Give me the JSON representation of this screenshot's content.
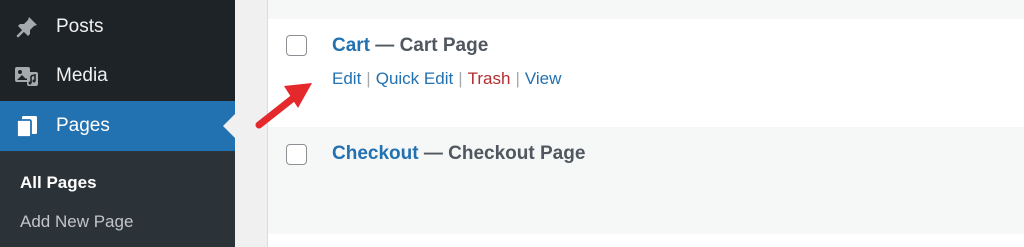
{
  "sidebar": {
    "items": [
      {
        "label": "Posts",
        "icon": "pushpin-icon"
      },
      {
        "label": "Media",
        "icon": "media-icon"
      },
      {
        "label": "Pages",
        "icon": "pages-icon"
      }
    ],
    "submenu": [
      {
        "label": "All Pages"
      },
      {
        "label": "Add New Page"
      }
    ]
  },
  "rows": [
    {
      "title": "Cart",
      "state": "— Cart Page",
      "actions": [
        {
          "label": "Edit"
        },
        {
          "label": "Quick Edit"
        },
        {
          "label": "Trash"
        },
        {
          "label": "View"
        }
      ]
    },
    {
      "title": "Checkout",
      "state": "— Checkout Page"
    }
  ],
  "colors": {
    "sidebar_bg": "#1d2327",
    "active_bg": "#2271b1",
    "link": "#2271b1",
    "trash": "#b32d2e",
    "annotation_arrow": "#e4282b"
  }
}
